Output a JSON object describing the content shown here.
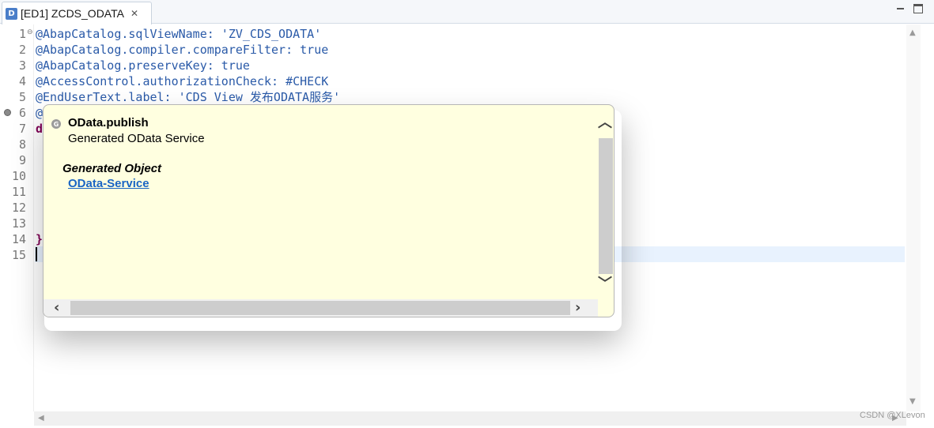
{
  "tab": {
    "icon_letter": "D",
    "title": "[ED1] ZCDS_ODATA",
    "close_glyph": "✕"
  },
  "editor": {
    "line_numbers": [
      "1",
      "2",
      "3",
      "4",
      "5",
      "6",
      "7",
      "8",
      "9",
      "10",
      "11",
      "12",
      "13",
      "14",
      "15"
    ],
    "lines": [
      "@AbapCatalog.sqlViewName: 'ZV_CDS_ODATA'",
      "@AbapCatalog.compiler.compareFilter: true",
      "@AbapCatalog.preserveKey: true",
      "@AccessControl.authorizationCheck: #CHECK",
      "@EndUserText.label: 'CDS View 发布ODATA服务'",
      "@",
      "d",
      "",
      "",
      "",
      "",
      "",
      "",
      "}",
      ""
    ],
    "current_line": 15
  },
  "popup": {
    "icon_letter": "G",
    "title": "OData.publish",
    "description": "Generated OData Service",
    "section_heading": "Generated Object",
    "link_text": "OData-Service"
  },
  "watermark": "CSDN @XLevon",
  "colors": {
    "annotation_text": "#2a5aa8",
    "keyword": "#7f0055",
    "popup_background": "#ffffe0",
    "link": "#1a65c4",
    "current_line_highlight": "#e8f2fe"
  }
}
